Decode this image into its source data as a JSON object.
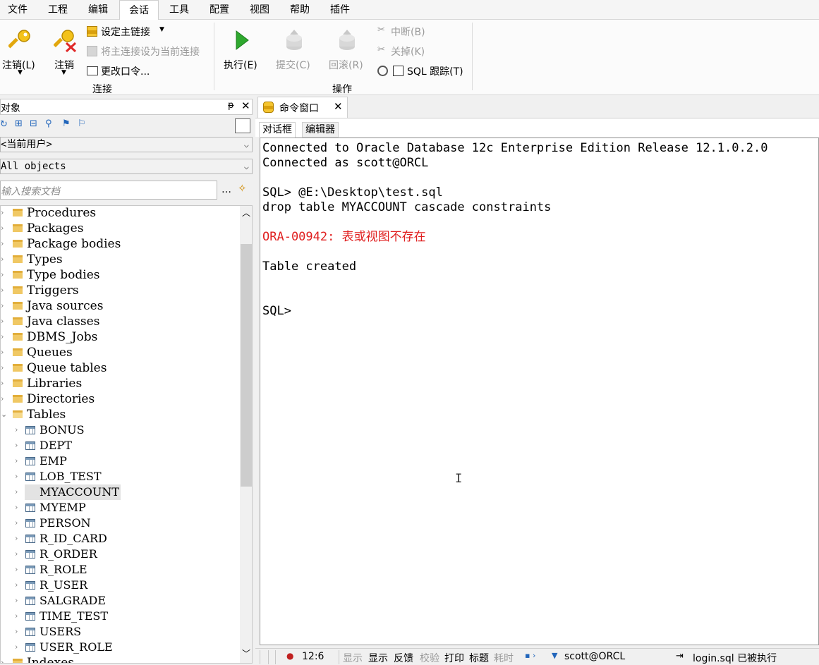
{
  "menu": [
    "文件",
    "工程",
    "编辑",
    "会话",
    "工具",
    "配置",
    "视图",
    "帮助",
    "插件"
  ],
  "ribbon": {
    "logon": "注销(L)",
    "logoff": "注销",
    "set_primary": "设定主链接",
    "set_primary_current": "将主连接设为当前连接",
    "change_password": "更改口令...",
    "group_connection": "连接",
    "execute": "执行(E)",
    "commit": "提交(C)",
    "rollback": "回滚(R)",
    "break": "中断(B)",
    "kill": "关掉(K)",
    "sql_trace": "SQL 跟踪(T)",
    "group_operation": "操作"
  },
  "left": {
    "title": "对象",
    "owner_select": "<当前用户>",
    "type_select": "All objects",
    "search_placeholder": "输入搜索文档",
    "folders": [
      "Procedures",
      "Packages",
      "Package bodies",
      "Types",
      "Type bodies",
      "Triggers",
      "Java sources",
      "Java classes",
      "DBMS_Jobs",
      "Queues",
      "Queue tables",
      "Libraries",
      "Directories",
      "Tables"
    ],
    "tables": [
      "BONUS",
      "DEPT",
      "EMP",
      "LOB_TEST",
      "MYACCOUNT",
      "MYEMP",
      "PERSON",
      "R_ID_CARD",
      "R_ORDER",
      "R_ROLE",
      "R_USER",
      "SALGRADE",
      "TIME_TEST",
      "USERS",
      "USER_ROLE"
    ],
    "next_folder": "Indexes",
    "selected_table": "MYACCOUNT"
  },
  "editor": {
    "tab_title": "命令窗口",
    "subtab_dialog": "对话框",
    "subtab_editor": "编辑器",
    "lines": [
      {
        "text": "Connected to Oracle Database 12c Enterprise Edition Release 12.1.0.2.0",
        "color": "#000000"
      },
      {
        "text": "Connected as scott@ORCL",
        "color": "#000000"
      },
      {
        "text": "",
        "color": "#000000"
      },
      {
        "text": "SQL> @E:\\Desktop\\test.sql",
        "color": "#000000"
      },
      {
        "text": "drop table MYACCOUNT cascade constraints",
        "color": "#000000"
      },
      {
        "text": "",
        "color": "#000000"
      },
      {
        "text": "ORA-00942: 表或视图不存在",
        "color": "#e02020"
      },
      {
        "text": "",
        "color": "#000000"
      },
      {
        "text": "Table created",
        "color": "#000000"
      },
      {
        "text": "",
        "color": "#000000"
      },
      {
        "text": "",
        "color": "#000000"
      },
      {
        "text": "SQL>",
        "color": "#000000"
      }
    ]
  },
  "status": {
    "position": "12:6",
    "show_dis": "显示",
    "show": "显示",
    "feedback": "反馈",
    "verify": "校验",
    "print": "打印",
    "heading": "标题",
    "timing": "耗时",
    "connection": "scott@ORCL",
    "message": "login.sql 已被执行"
  }
}
